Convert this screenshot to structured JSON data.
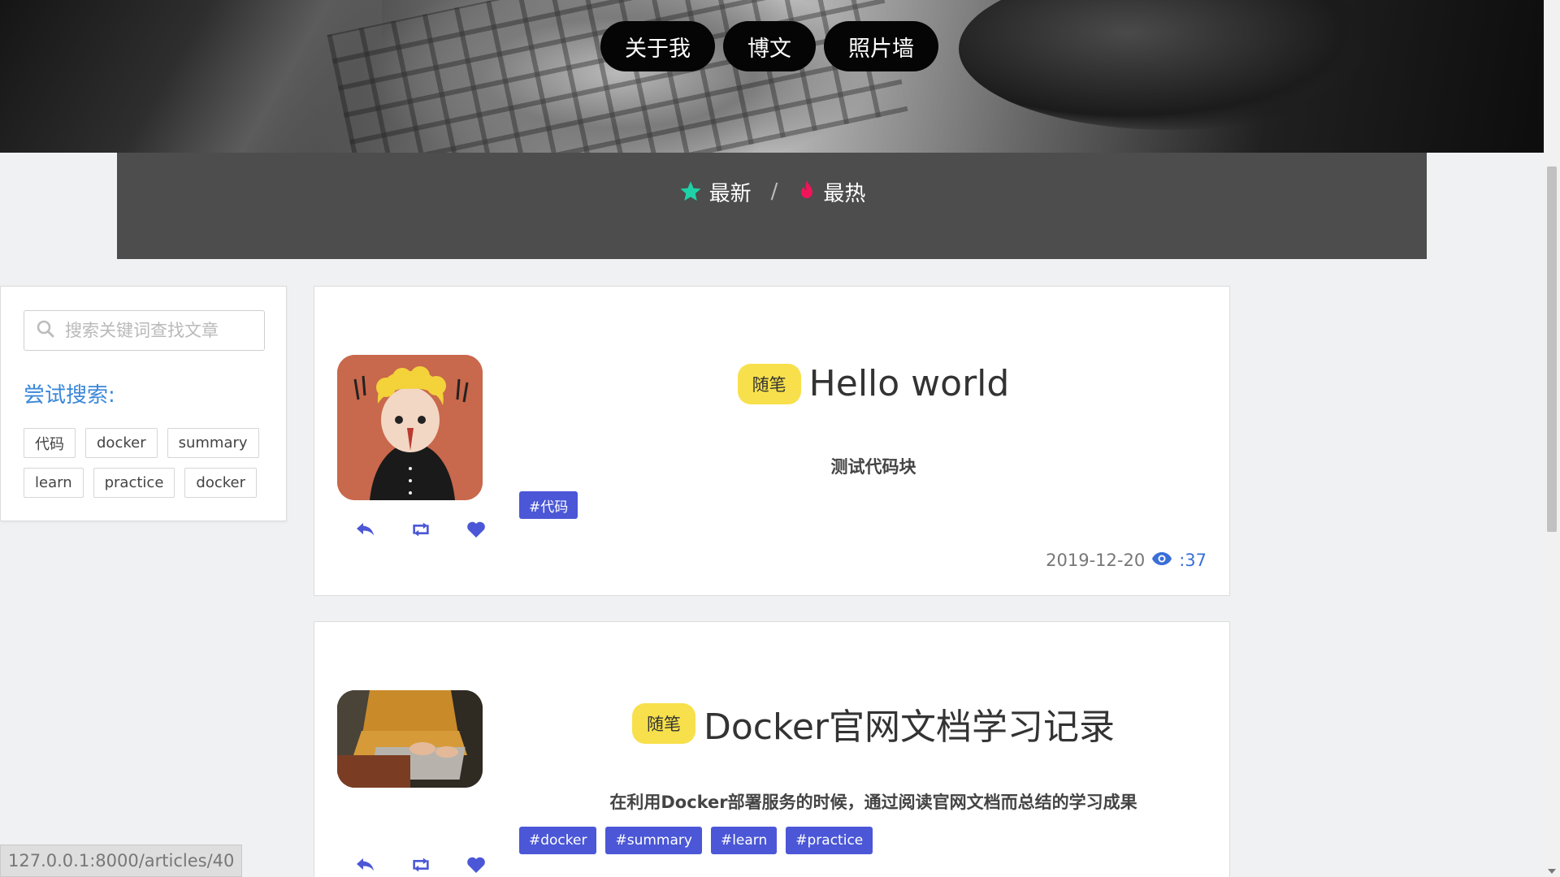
{
  "nav": {
    "items": [
      {
        "label": "关于我"
      },
      {
        "label": "博文"
      },
      {
        "label": "照片墙"
      }
    ]
  },
  "tabs": {
    "latest": {
      "label": "最新",
      "icon": "star-icon",
      "color": "#1fd1a7"
    },
    "separator": "/",
    "hot": {
      "label": "最热",
      "icon": "flame-icon",
      "color": "#f0145a"
    }
  },
  "sidebar": {
    "search_placeholder": "搜索关键词查找文章",
    "try_label": "尝试搜索:",
    "suggested_tags": [
      "代码",
      "docker",
      "summary",
      "learn",
      "practice",
      "docker"
    ]
  },
  "articles": [
    {
      "category": "随笔",
      "title": "Hello world",
      "summary": "测试代码块",
      "tags": [
        "#代码"
      ],
      "date": "2019-12-20",
      "views": ":37"
    },
    {
      "category": "随笔",
      "title": "Docker官网文档学习记录",
      "summary": "在利用Docker部署服务的时候，通过阅读官网文档而总结的学习成果",
      "tags": [
        "#docker",
        "#summary",
        "#learn",
        "#practice"
      ]
    }
  ],
  "status_bar": {
    "url": "127.0.0.1:8000/articles/40"
  },
  "colors": {
    "accent_blue": "#4b57d6",
    "category_yellow": "#f7e04b",
    "link_blue": "#3a87d9",
    "panel_gray": "#4d4d4d"
  }
}
